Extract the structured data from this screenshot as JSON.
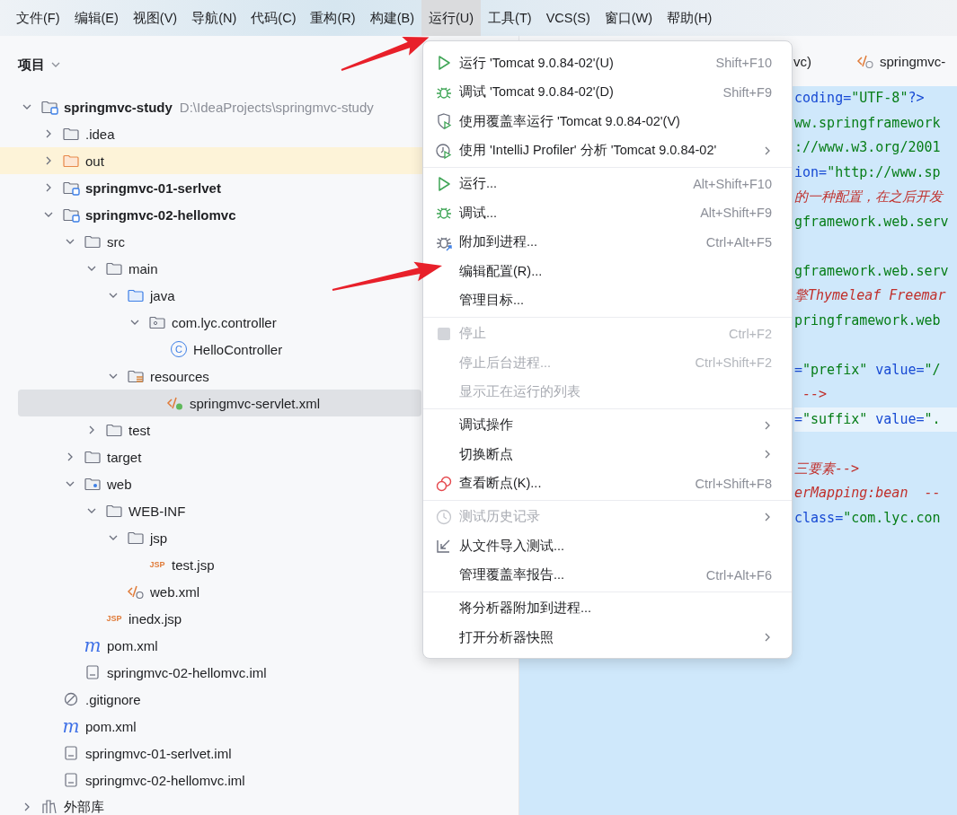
{
  "menubar": [
    {
      "label": "文件(F)",
      "selected": false
    },
    {
      "label": "编辑(E)",
      "selected": false
    },
    {
      "label": "视图(V)",
      "selected": false
    },
    {
      "label": "导航(N)",
      "selected": false
    },
    {
      "label": "代码(C)",
      "selected": false
    },
    {
      "label": "重构(R)",
      "selected": false
    },
    {
      "label": "构建(B)",
      "selected": false
    },
    {
      "label": "运行(U)",
      "selected": true
    },
    {
      "label": "工具(T)",
      "selected": false
    },
    {
      "label": "VCS(S)",
      "selected": false
    },
    {
      "label": "窗口(W)",
      "selected": false
    },
    {
      "label": "帮助(H)",
      "selected": false
    }
  ],
  "project_panel": {
    "title": "项目"
  },
  "tree": [
    {
      "label": "springmvc-study",
      "path": "D:\\IdeaProjects\\springmvc-study",
      "kind": "module",
      "expanded": true,
      "selected": false,
      "children": [
        {
          "label": ".idea",
          "kind": "folder",
          "expanded": false,
          "selected": false
        },
        {
          "label": "out",
          "kind": "excluded",
          "expanded": false,
          "selected": false
        },
        {
          "label": "springmvc-01-serlvet",
          "kind": "module",
          "expanded": false,
          "selected": false
        },
        {
          "label": "springmvc-02-hellomvc",
          "kind": "module",
          "expanded": true,
          "selected": false,
          "children": [
            {
              "label": "src",
              "kind": "folder",
              "expanded": true,
              "selected": false,
              "children": [
                {
                  "label": "main",
                  "kind": "folder",
                  "expanded": true,
                  "selected": false,
                  "children": [
                    {
                      "label": "java",
                      "kind": "source",
                      "expanded": true,
                      "selected": false,
                      "children": [
                        {
                          "label": "com.lyc.controller",
                          "kind": "package",
                          "expanded": true,
                          "selected": false,
                          "children": [
                            {
                              "label": "HelloController",
                              "kind": "class",
                              "icon_text": "C",
                              "selected": false
                            }
                          ]
                        }
                      ]
                    },
                    {
                      "label": "resources",
                      "kind": "resources",
                      "expanded": true,
                      "selected": false,
                      "children": [
                        {
                          "label": "springmvc-servlet.xml",
                          "kind": "xml",
                          "selected": true
                        }
                      ]
                    }
                  ]
                },
                {
                  "label": "test",
                  "kind": "folder",
                  "expanded": false,
                  "selected": false
                }
              ]
            },
            {
              "label": "target",
              "kind": "folder",
              "expanded": false,
              "selected": false
            },
            {
              "label": "web",
              "kind": "webroot",
              "expanded": true,
              "selected": false,
              "children": [
                {
                  "label": "WEB-INF",
                  "kind": "folder",
                  "expanded": true,
                  "selected": false,
                  "children": [
                    {
                      "label": "jsp",
                      "kind": "folder",
                      "expanded": true,
                      "selected": false,
                      "children": [
                        {
                          "label": "test.jsp",
                          "kind": "jsp",
                          "icon_text": "JSP",
                          "selected": false
                        }
                      ]
                    },
                    {
                      "label": "web.xml",
                      "kind": "webxml",
                      "selected": false
                    }
                  ]
                },
                {
                  "label": "inedx.jsp",
                  "kind": "jsp",
                  "icon_text": "JSP",
                  "selected": false
                }
              ]
            },
            {
              "label": "pom.xml",
              "kind": "maven",
              "icon_text": "m",
              "selected": false
            },
            {
              "label": "springmvc-02-hellomvc.iml",
              "kind": "iml",
              "selected": false
            }
          ]
        },
        {
          "label": ".gitignore",
          "kind": "ignore",
          "selected": false
        },
        {
          "label": "pom.xml",
          "kind": "maven",
          "icon_text": "m",
          "selected": false
        },
        {
          "label": "springmvc-01-serlvet.iml",
          "kind": "iml",
          "selected": false
        },
        {
          "label": "springmvc-02-hellomvc.iml",
          "kind": "iml",
          "selected": false
        }
      ]
    },
    {
      "label": "外部库",
      "kind": "library",
      "expanded": false,
      "selected": false
    }
  ],
  "editor": {
    "tabs": [
      {
        "label": "vc)",
        "kind": "plain"
      },
      {
        "label": "springmvc-",
        "kind": "xml"
      }
    ],
    "lines": [
      {
        "kind": "code",
        "current": false,
        "segments": [
          {
            "kind": "attr",
            "text": "coding="
          },
          {
            "kind": "string",
            "text": "\"UTF-8\""
          },
          {
            "kind": "attr",
            "text": "?>"
          }
        ]
      },
      {
        "kind": "code",
        "current": false,
        "segments": [
          {
            "kind": "string",
            "text": "ww.springframework"
          }
        ]
      },
      {
        "kind": "code",
        "current": false,
        "segments": [
          {
            "kind": "string",
            "text": "://www.w3.org/2001"
          }
        ]
      },
      {
        "kind": "code",
        "current": false,
        "segments": [
          {
            "kind": "attr",
            "text": "ion="
          },
          {
            "kind": "string",
            "text": "\"http://www.sp"
          }
        ]
      },
      {
        "kind": "code",
        "current": false,
        "segments": [
          {
            "kind": "comment",
            "text": "的一种配置，在之后开发"
          }
        ]
      },
      {
        "kind": "code",
        "current": false,
        "segments": [
          {
            "kind": "string",
            "text": "gframework.web.serv"
          }
        ]
      },
      {
        "kind": "blank",
        "current": false
      },
      {
        "kind": "code",
        "current": false,
        "segments": [
          {
            "kind": "string",
            "text": "gframework.web.serv"
          }
        ]
      },
      {
        "kind": "code",
        "current": false,
        "segments": [
          {
            "kind": "comment",
            "text": "擎Thymeleaf Freemar"
          }
        ]
      },
      {
        "kind": "code",
        "current": false,
        "segments": [
          {
            "kind": "string",
            "text": "pringframework.web"
          }
        ]
      },
      {
        "kind": "blank",
        "current": false
      },
      {
        "kind": "code",
        "current": false,
        "segments": [
          {
            "kind": "attr",
            "text": "="
          },
          {
            "kind": "string",
            "text": "\"prefix\""
          },
          {
            "kind": "attr",
            "text": " value="
          },
          {
            "kind": "string",
            "text": "\"/"
          }
        ]
      },
      {
        "kind": "code",
        "current": false,
        "segments": [
          {
            "kind": "comment",
            "text": " -->"
          }
        ]
      },
      {
        "kind": "code",
        "current": true,
        "segments": [
          {
            "kind": "attr",
            "text": "="
          },
          {
            "kind": "string",
            "text": "\"suffix\""
          },
          {
            "kind": "attr",
            "text": " value="
          },
          {
            "kind": "string",
            "text": "\"."
          }
        ]
      },
      {
        "kind": "blank",
        "current": false
      },
      {
        "kind": "code",
        "current": false,
        "segments": [
          {
            "kind": "comment",
            "text": "三要素-->"
          }
        ]
      },
      {
        "kind": "code",
        "current": false,
        "segments": [
          {
            "kind": "comment",
            "text": "erMapping:bean  --"
          }
        ]
      },
      {
        "kind": "code",
        "current": false,
        "segments": [
          {
            "kind": "attr",
            "text": "class="
          },
          {
            "kind": "string",
            "text": "\"com.lyc.con"
          }
        ]
      }
    ]
  },
  "menu": {
    "groups": [
      {
        "items": [
          {
            "label": "运行 'Tomcat 9.0.84-02'(U)",
            "kind": "run",
            "shortcut": "Shift+F10",
            "disabled": false,
            "submenu": false
          },
          {
            "label": "调试 'Tomcat 9.0.84-02'(D)",
            "kind": "debug",
            "shortcut": "Shift+F9",
            "disabled": false,
            "submenu": false
          },
          {
            "label": "使用覆盖率运行 'Tomcat 9.0.84-02'(V)",
            "kind": "coverage",
            "disabled": false,
            "submenu": false
          },
          {
            "label": "使用 'IntelliJ Profiler' 分析  'Tomcat 9.0.84-02'",
            "kind": "profiler",
            "disabled": false,
            "submenu": true
          }
        ]
      },
      {
        "items": [
          {
            "label": "运行...",
            "kind": "run",
            "shortcut": "Alt+Shift+F10",
            "disabled": false,
            "submenu": false
          },
          {
            "label": "调试...",
            "kind": "debug",
            "shortcut": "Alt+Shift+F9",
            "disabled": false,
            "submenu": false
          },
          {
            "label": "附加到进程...",
            "kind": "attach",
            "shortcut": "Ctrl+Alt+F5",
            "disabled": false,
            "submenu": false
          },
          {
            "label": "编辑配置(R)...",
            "kind": "plain",
            "disabled": false,
            "submenu": false
          },
          {
            "label": "管理目标...",
            "kind": "plain",
            "disabled": false,
            "submenu": false
          }
        ]
      },
      {
        "items": [
          {
            "label": "停止",
            "kind": "stop",
            "shortcut": "Ctrl+F2",
            "disabled": true,
            "submenu": false
          },
          {
            "label": "停止后台进程...",
            "kind": "plain",
            "shortcut": "Ctrl+Shift+F2",
            "disabled": true,
            "submenu": false
          },
          {
            "label": "显示正在运行的列表",
            "kind": "plain",
            "disabled": true,
            "submenu": false
          }
        ]
      },
      {
        "items": [
          {
            "label": "调试操作",
            "kind": "plain",
            "disabled": false,
            "submenu": true
          },
          {
            "label": "切换断点",
            "kind": "plain",
            "disabled": false,
            "submenu": true
          },
          {
            "label": "查看断点(K)...",
            "kind": "breakpoints",
            "shortcut": "Ctrl+Shift+F8",
            "disabled": false,
            "submenu": false
          }
        ]
      },
      {
        "items": [
          {
            "label": "测试历史记录",
            "kind": "history",
            "disabled": true,
            "submenu": true
          },
          {
            "label": "从文件导入测试...",
            "kind": "import",
            "disabled": false,
            "submenu": false
          },
          {
            "label": "管理覆盖率报告...",
            "kind": "plain",
            "shortcut": "Ctrl+Alt+F6",
            "disabled": false,
            "submenu": false
          }
        ]
      },
      {
        "items": [
          {
            "label": "将分析器附加到进程...",
            "kind": "plain",
            "disabled": false,
            "submenu": false
          },
          {
            "label": "打开分析器快照",
            "kind": "plain",
            "disabled": false,
            "submenu": true
          }
        ]
      }
    ]
  }
}
